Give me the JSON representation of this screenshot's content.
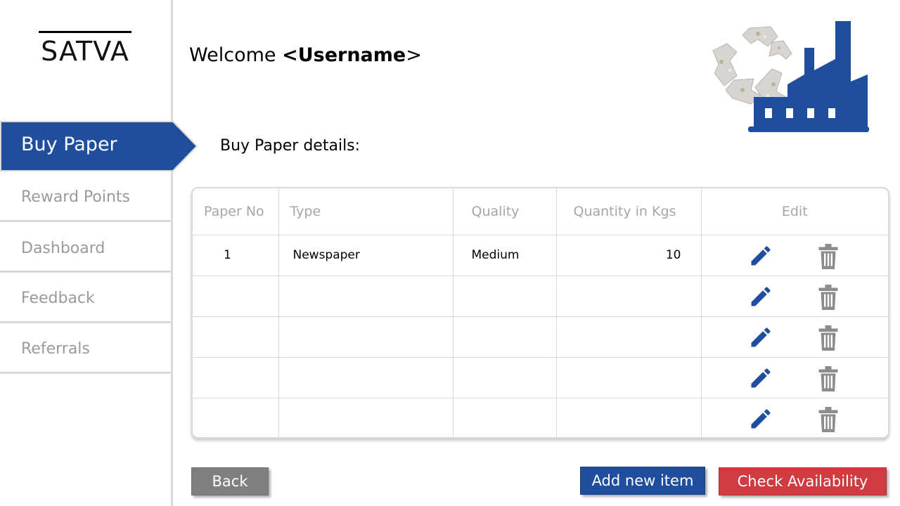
{
  "brand": {
    "logo_text": "SATVA"
  },
  "sidebar": {
    "active": "Buy Paper",
    "items": [
      "Reward Points",
      "Dashboard",
      "Feedback",
      "Referrals"
    ]
  },
  "header": {
    "welcome_prefix": "Welcome ",
    "username_token": "<Username",
    "welcome_suffix": ">"
  },
  "main": {
    "section_title": "Buy Paper details:",
    "table": {
      "columns": [
        "Paper No",
        "Type",
        "Quality",
        "Quantity in Kgs",
        "Edit"
      ],
      "rows": [
        [
          "1",
          "Newspaper",
          "Medium",
          "10"
        ],
        [
          "",
          "",
          "",
          ""
        ],
        [
          "",
          "",
          "",
          ""
        ],
        [
          "",
          "",
          "",
          ""
        ],
        [
          "",
          "",
          "",
          ""
        ]
      ]
    }
  },
  "actions": {
    "back": "Back",
    "add": "Add new item",
    "check": "Check Availability"
  },
  "colors": {
    "primary_blue": "#1f4e9e",
    "danger_red": "#d13b3f",
    "neutral_gray": "#7f7f7f"
  },
  "icons": {
    "edit": "pencil-icon",
    "delete": "trash-icon",
    "header_graphic": "recycle-factory-icon"
  }
}
